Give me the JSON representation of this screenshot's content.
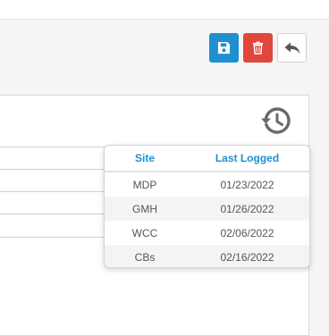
{
  "toolbar": {
    "save_icon": "save-icon",
    "delete_icon": "trash-icon",
    "back_icon": "reply-arrow-icon"
  },
  "colors": {
    "accent": "#1f8fd1",
    "danger": "#e0473a",
    "header_text": "#1f8fd1"
  },
  "history_popover": {
    "columns": {
      "site": "Site",
      "last_logged": "Last Logged"
    },
    "rows": [
      {
        "site": "MDP",
        "last_logged": "01/23/2022"
      },
      {
        "site": "GMH",
        "last_logged": "01/26/2022"
      },
      {
        "site": "WCC",
        "last_logged": "02/06/2022"
      },
      {
        "site": "CBs",
        "last_logged": "02/16/2022"
      }
    ]
  }
}
